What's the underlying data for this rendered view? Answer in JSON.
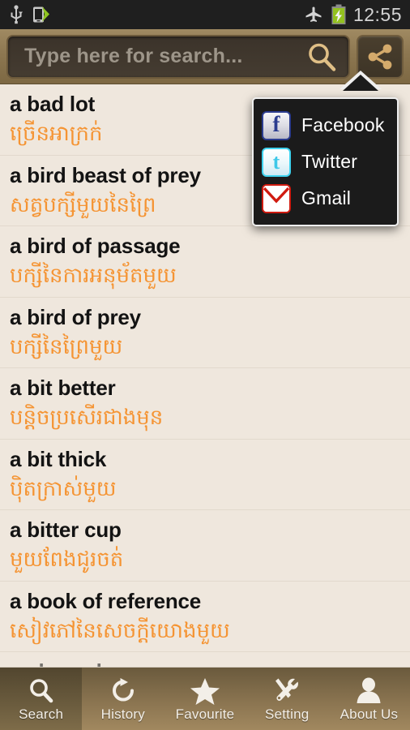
{
  "statusbar": {
    "time": "12:55",
    "icons": [
      "usb-icon",
      "usb-transfer-icon",
      "airplane-mode-icon",
      "battery-charging-icon"
    ]
  },
  "search": {
    "placeholder": "Type here for search...",
    "value": "",
    "search_icon": "magnifier-icon",
    "share_icon": "share-icon"
  },
  "share_menu": {
    "visible": true,
    "items": [
      {
        "label": "Facebook",
        "icon": "facebook-icon",
        "glyph": "f"
      },
      {
        "label": "Twitter",
        "icon": "twitter-icon",
        "glyph": "t"
      },
      {
        "label": "Gmail",
        "icon": "gmail-icon",
        "glyph": "envelope"
      }
    ]
  },
  "colors": {
    "accent_orange": "#f59433",
    "list_background": "#efe7dd",
    "bar_brown": "#8d7751",
    "statusbar_black": "#1f1f1f",
    "menu_black": "#1b1b1b",
    "english_text": "#131313"
  },
  "list": {
    "entries": [
      {
        "en": "a bad lot",
        "km": "ច្រើនអាក្រក់"
      },
      {
        "en": "a bird beast of prey",
        "km": "សត្វបក្សីមួយនៃព្រៃ"
      },
      {
        "en": "a bird of passage",
        "km": "បក្សីនៃការអនុម័តមួយ"
      },
      {
        "en": "a bird of prey",
        "km": "បក្សីនៃព្រៃមួយ"
      },
      {
        "en": "a bit better",
        "km": "បន្តិចប្រសើរជាងមុន"
      },
      {
        "en": "a bit thick",
        "km": "ប៉ិតក្រាស់មួយ"
      },
      {
        "en": "a bitter cup",
        "km": "មួយពែងជូរចត់"
      },
      {
        "en": "a book of reference",
        "km": "សៀវភៅនៃសេចក្តីយោងមួយ"
      },
      {
        "en": "a class above",
        "km": ""
      }
    ]
  },
  "tabbar": {
    "active_index": 0,
    "tabs": [
      {
        "label": "Search",
        "icon": "search-icon"
      },
      {
        "label": "History",
        "icon": "history-icon"
      },
      {
        "label": "Favourite",
        "icon": "star-icon"
      },
      {
        "label": "Setting",
        "icon": "tools-icon"
      },
      {
        "label": "About Us",
        "icon": "person-icon"
      }
    ]
  }
}
